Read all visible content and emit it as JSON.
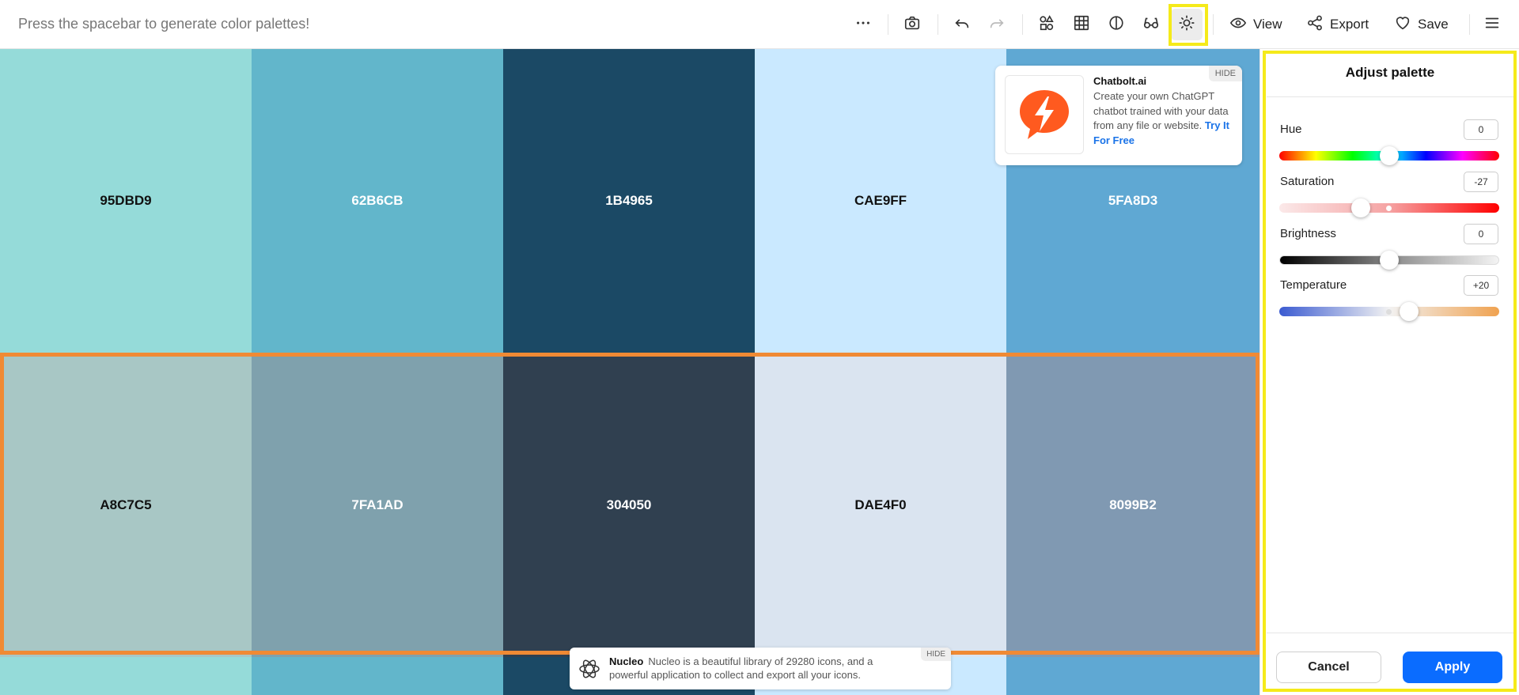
{
  "toolbar": {
    "hint": "Press the spacebar to generate color palettes!",
    "view_label": "View",
    "export_label": "Export",
    "save_label": "Save"
  },
  "palette": {
    "rows": [
      [
        "95DBD9",
        "62B6CB",
        "1B4965",
        "CAE9FF",
        "5FA8D3"
      ],
      [
        "A8C7C5",
        "7FA1AD",
        "304050",
        "DAE4F0",
        "8099B2"
      ],
      [
        "95DBD9",
        "62B6CB",
        "1B4965",
        "CAE9FF",
        "5FA8D3"
      ]
    ],
    "text_colors": [
      [
        "#111111",
        "#ffffff",
        "#ffffff",
        "#111111",
        "#ffffff"
      ],
      [
        "#111111",
        "#ffffff",
        "#ffffff",
        "#111111",
        "#ffffff"
      ]
    ]
  },
  "ad_top": {
    "title": "Chatbolt.ai",
    "text": "Create your own ChatGPT chatbot trained with your data from any file or website.",
    "link": "Try It For Free",
    "hide": "HIDE",
    "brand_color": "#ff5a1f"
  },
  "ad_bottom": {
    "title": "Nucleo",
    "text": "Nucleo is a beautiful library of 29280 icons, and a powerful application to collect and export all your icons.",
    "hide": "HIDE"
  },
  "panel": {
    "title": "Adjust palette",
    "controls": [
      {
        "label": "Hue",
        "value": "0",
        "fraction": 0.5
      },
      {
        "label": "Saturation",
        "value": "-27",
        "fraction": 0.37
      },
      {
        "label": "Brightness",
        "value": "0",
        "fraction": 0.5
      },
      {
        "label": "Temperature",
        "value": "+20",
        "fraction": 0.59
      }
    ],
    "cancel_label": "Cancel",
    "apply_label": "Apply"
  },
  "colors": {
    "accent": "#0a6cff",
    "highlight_yellow": "#f5ea1a",
    "selection_orange": "#f08a34"
  }
}
